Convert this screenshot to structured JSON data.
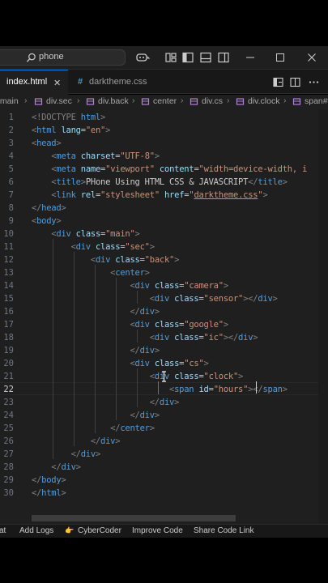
{
  "titlebar": {
    "search_text": "phone",
    "icons": [
      "search-icon",
      "copilot-icon",
      "layout-icon",
      "toggle-primary-sidebar-icon",
      "toggle-panel-icon",
      "toggle-secondary-sidebar-icon"
    ],
    "window_controls": [
      "minimize",
      "maximize",
      "close"
    ]
  },
  "tabs": [
    {
      "label": "index.html",
      "active": true
    },
    {
      "label": "darktheme.css",
      "active": false,
      "icon_glyph": "#"
    }
  ],
  "tab_close_glyph": "✕",
  "breadcrumb": {
    "items": [
      ".main",
      "div.sec",
      "div.back",
      "center",
      "div.cs",
      "div.clock",
      "span#"
    ]
  },
  "editor": {
    "line_numbers": [
      "1",
      "2",
      "3",
      "4",
      "5",
      "6",
      "7",
      "8",
      "9",
      "10",
      "11",
      "12",
      "13",
      "14",
      "15",
      "16",
      "17",
      "18",
      "19",
      "20",
      "21",
      "22",
      "23",
      "24",
      "25",
      "26",
      "27",
      "28",
      "29",
      "30"
    ],
    "current_line": "22",
    "lines": [
      [
        {
          "c": "t-doctype",
          "t": "<!DOCTYPE "
        },
        {
          "c": "t-tag",
          "t": "html"
        },
        {
          "c": "t-doctype",
          "t": ">"
        }
      ],
      [
        {
          "c": "t-bracket",
          "t": "<"
        },
        {
          "c": "t-tag",
          "t": "html"
        },
        {
          "c": "t-text",
          "t": " "
        },
        {
          "c": "t-attr",
          "t": "lang"
        },
        {
          "c": "t-eq",
          "t": "="
        },
        {
          "c": "t-str",
          "t": "\"en\""
        },
        {
          "c": "t-bracket",
          "t": ">"
        }
      ],
      [
        {
          "c": "t-bracket",
          "t": "<"
        },
        {
          "c": "t-tag",
          "t": "head"
        },
        {
          "c": "t-bracket",
          "t": ">"
        }
      ],
      [
        {
          "c": "t-text",
          "t": "    "
        },
        {
          "c": "t-bracket",
          "t": "<"
        },
        {
          "c": "t-tag",
          "t": "meta"
        },
        {
          "c": "t-text",
          "t": " "
        },
        {
          "c": "t-attr",
          "t": "charset"
        },
        {
          "c": "t-eq",
          "t": "="
        },
        {
          "c": "t-str",
          "t": "\"UTF-8\""
        },
        {
          "c": "t-bracket",
          "t": ">"
        }
      ],
      [
        {
          "c": "t-text",
          "t": "    "
        },
        {
          "c": "t-bracket",
          "t": "<"
        },
        {
          "c": "t-tag",
          "t": "meta"
        },
        {
          "c": "t-text",
          "t": " "
        },
        {
          "c": "t-attr",
          "t": "name"
        },
        {
          "c": "t-eq",
          "t": "="
        },
        {
          "c": "t-str",
          "t": "\"viewport\""
        },
        {
          "c": "t-text",
          "t": " "
        },
        {
          "c": "t-attr",
          "t": "content"
        },
        {
          "c": "t-eq",
          "t": "="
        },
        {
          "c": "t-str",
          "t": "\"width=device-width, i"
        }
      ],
      [
        {
          "c": "t-text",
          "t": "    "
        },
        {
          "c": "t-bracket",
          "t": "<"
        },
        {
          "c": "t-tag",
          "t": "title"
        },
        {
          "c": "t-bracket",
          "t": ">"
        },
        {
          "c": "t-text",
          "t": "PHone Using HTML CSS & JAVASCRIPT"
        },
        {
          "c": "t-bracket",
          "t": "</"
        },
        {
          "c": "t-tag",
          "t": "title"
        },
        {
          "c": "t-bracket",
          "t": ">"
        }
      ],
      [
        {
          "c": "t-text",
          "t": "    "
        },
        {
          "c": "t-bracket",
          "t": "<"
        },
        {
          "c": "t-tag",
          "t": "link"
        },
        {
          "c": "t-text",
          "t": " "
        },
        {
          "c": "t-attr",
          "t": "rel"
        },
        {
          "c": "t-eq",
          "t": "="
        },
        {
          "c": "t-str",
          "t": "\"stylesheet\""
        },
        {
          "c": "t-text",
          "t": " "
        },
        {
          "c": "t-attr",
          "t": "href"
        },
        {
          "c": "t-eq",
          "t": "="
        },
        {
          "c": "t-str",
          "t": "\""
        },
        {
          "c": "t-link",
          "t": "darktheme.css"
        },
        {
          "c": "t-str",
          "t": "\""
        },
        {
          "c": "t-bracket",
          "t": ">"
        }
      ],
      [
        {
          "c": "t-bracket",
          "t": "</"
        },
        {
          "c": "t-tag",
          "t": "head"
        },
        {
          "c": "t-bracket",
          "t": ">"
        }
      ],
      [
        {
          "c": "t-bracket",
          "t": "<"
        },
        {
          "c": "t-tag",
          "t": "body"
        },
        {
          "c": "t-bracket",
          "t": ">"
        }
      ],
      [
        {
          "c": "t-text",
          "t": "    "
        },
        {
          "c": "t-bracket",
          "t": "<"
        },
        {
          "c": "t-tag",
          "t": "div"
        },
        {
          "c": "t-text",
          "t": " "
        },
        {
          "c": "t-attr",
          "t": "class"
        },
        {
          "c": "t-eq",
          "t": "="
        },
        {
          "c": "t-str",
          "t": "\"main\""
        },
        {
          "c": "t-bracket",
          "t": ">"
        }
      ],
      [
        {
          "c": "t-text",
          "t": "        "
        },
        {
          "c": "t-bracket",
          "t": "<"
        },
        {
          "c": "t-tag",
          "t": "div"
        },
        {
          "c": "t-text",
          "t": " "
        },
        {
          "c": "t-attr",
          "t": "class"
        },
        {
          "c": "t-eq",
          "t": "="
        },
        {
          "c": "t-str",
          "t": "\"sec\""
        },
        {
          "c": "t-bracket",
          "t": ">"
        }
      ],
      [
        {
          "c": "t-text",
          "t": "            "
        },
        {
          "c": "t-bracket",
          "t": "<"
        },
        {
          "c": "t-tag",
          "t": "div"
        },
        {
          "c": "t-text",
          "t": " "
        },
        {
          "c": "t-attr",
          "t": "class"
        },
        {
          "c": "t-eq",
          "t": "="
        },
        {
          "c": "t-str",
          "t": "\"back\""
        },
        {
          "c": "t-bracket",
          "t": ">"
        }
      ],
      [
        {
          "c": "t-text",
          "t": "                "
        },
        {
          "c": "t-bracket",
          "t": "<"
        },
        {
          "c": "t-tag",
          "t": "center"
        },
        {
          "c": "t-bracket",
          "t": ">"
        }
      ],
      [
        {
          "c": "t-text",
          "t": "                    "
        },
        {
          "c": "t-bracket",
          "t": "<"
        },
        {
          "c": "t-tag",
          "t": "div"
        },
        {
          "c": "t-text",
          "t": " "
        },
        {
          "c": "t-attr",
          "t": "class"
        },
        {
          "c": "t-eq",
          "t": "="
        },
        {
          "c": "t-str",
          "t": "\"camera\""
        },
        {
          "c": "t-bracket",
          "t": ">"
        }
      ],
      [
        {
          "c": "t-text",
          "t": "                        "
        },
        {
          "c": "t-bracket",
          "t": "<"
        },
        {
          "c": "t-tag",
          "t": "div"
        },
        {
          "c": "t-text",
          "t": " "
        },
        {
          "c": "t-attr",
          "t": "class"
        },
        {
          "c": "t-eq",
          "t": "="
        },
        {
          "c": "t-str",
          "t": "\"sensor\""
        },
        {
          "c": "t-bracket",
          "t": "></"
        },
        {
          "c": "t-tag",
          "t": "div"
        },
        {
          "c": "t-bracket",
          "t": ">"
        }
      ],
      [
        {
          "c": "t-text",
          "t": "                    "
        },
        {
          "c": "t-bracket",
          "t": "</"
        },
        {
          "c": "t-tag",
          "t": "div"
        },
        {
          "c": "t-bracket",
          "t": ">"
        }
      ],
      [
        {
          "c": "t-text",
          "t": "                    "
        },
        {
          "c": "t-bracket",
          "t": "<"
        },
        {
          "c": "t-tag",
          "t": "div"
        },
        {
          "c": "t-text",
          "t": " "
        },
        {
          "c": "t-attr",
          "t": "class"
        },
        {
          "c": "t-eq",
          "t": "="
        },
        {
          "c": "t-str",
          "t": "\"google\""
        },
        {
          "c": "t-bracket",
          "t": ">"
        }
      ],
      [
        {
          "c": "t-text",
          "t": "                        "
        },
        {
          "c": "t-bracket",
          "t": "<"
        },
        {
          "c": "t-tag",
          "t": "div"
        },
        {
          "c": "t-text",
          "t": " "
        },
        {
          "c": "t-attr",
          "t": "class"
        },
        {
          "c": "t-eq",
          "t": "="
        },
        {
          "c": "t-str",
          "t": "\"ic\""
        },
        {
          "c": "t-bracket",
          "t": "></"
        },
        {
          "c": "t-tag",
          "t": "div"
        },
        {
          "c": "t-bracket",
          "t": ">"
        }
      ],
      [
        {
          "c": "t-text",
          "t": "                    "
        },
        {
          "c": "t-bracket",
          "t": "</"
        },
        {
          "c": "t-tag",
          "t": "div"
        },
        {
          "c": "t-bracket",
          "t": ">"
        }
      ],
      [
        {
          "c": "t-text",
          "t": "                    "
        },
        {
          "c": "t-bracket",
          "t": "<"
        },
        {
          "c": "t-tag",
          "t": "div"
        },
        {
          "c": "t-text",
          "t": " "
        },
        {
          "c": "t-attr",
          "t": "class"
        },
        {
          "c": "t-eq",
          "t": "="
        },
        {
          "c": "t-str",
          "t": "\"cs\""
        },
        {
          "c": "t-bracket",
          "t": ">"
        }
      ],
      [
        {
          "c": "t-text",
          "t": "                        "
        },
        {
          "c": "t-bracket",
          "t": "<"
        },
        {
          "c": "t-tag",
          "t": "div"
        },
        {
          "c": "t-text",
          "t": " "
        },
        {
          "c": "t-attr",
          "t": "class"
        },
        {
          "c": "t-eq",
          "t": "="
        },
        {
          "c": "t-str",
          "t": "\"clock\""
        },
        {
          "c": "t-bracket",
          "t": ">"
        }
      ],
      [
        {
          "c": "t-text",
          "t": "                            "
        },
        {
          "c": "t-bracket",
          "t": "<"
        },
        {
          "c": "t-tag",
          "t": "span"
        },
        {
          "c": "t-text",
          "t": " "
        },
        {
          "c": "t-attr",
          "t": "id"
        },
        {
          "c": "t-eq",
          "t": "="
        },
        {
          "c": "t-str",
          "t": "\"hours\""
        },
        {
          "c": "t-bracket",
          "t": "></"
        },
        {
          "c": "t-tag",
          "t": "span"
        },
        {
          "c": "t-bracket",
          "t": ">"
        }
      ],
      [
        {
          "c": "t-text",
          "t": "                        "
        },
        {
          "c": "t-bracket",
          "t": "</"
        },
        {
          "c": "t-tag",
          "t": "div"
        },
        {
          "c": "t-bracket",
          "t": ">"
        }
      ],
      [
        {
          "c": "t-text",
          "t": "                    "
        },
        {
          "c": "t-bracket",
          "t": "</"
        },
        {
          "c": "t-tag",
          "t": "div"
        },
        {
          "c": "t-bracket",
          "t": ">"
        }
      ],
      [
        {
          "c": "t-text",
          "t": "                "
        },
        {
          "c": "t-bracket",
          "t": "</"
        },
        {
          "c": "t-tag",
          "t": "center"
        },
        {
          "c": "t-bracket",
          "t": ">"
        }
      ],
      [
        {
          "c": "t-text",
          "t": "            "
        },
        {
          "c": "t-bracket",
          "t": "</"
        },
        {
          "c": "t-tag",
          "t": "div"
        },
        {
          "c": "t-bracket",
          "t": ">"
        }
      ],
      [
        {
          "c": "t-text",
          "t": "        "
        },
        {
          "c": "t-bracket",
          "t": "</"
        },
        {
          "c": "t-tag",
          "t": "div"
        },
        {
          "c": "t-bracket",
          "t": ">"
        }
      ],
      [
        {
          "c": "t-text",
          "t": "    "
        },
        {
          "c": "t-bracket",
          "t": "</"
        },
        {
          "c": "t-tag",
          "t": "div"
        },
        {
          "c": "t-bracket",
          "t": ">"
        }
      ],
      [
        {
          "c": "t-bracket",
          "t": "</"
        },
        {
          "c": "t-tag",
          "t": "body"
        },
        {
          "c": "t-bracket",
          "t": ">"
        }
      ],
      [
        {
          "c": "t-bracket",
          "t": "</"
        },
        {
          "c": "t-tag",
          "t": "html"
        },
        {
          "c": "t-bracket",
          "t": ">"
        }
      ]
    ]
  },
  "statusbar": {
    "items": [
      "at",
      "Add Logs",
      "CyberCoder",
      "Improve Code",
      "Share Code Link"
    ],
    "cybercoder_glyph": "👉"
  },
  "colors": {
    "accent": "#0078d4",
    "editor_bg": "#1f1f1f",
    "tag": "#569cd6",
    "attr": "#9cdcfe",
    "string": "#ce9178"
  }
}
